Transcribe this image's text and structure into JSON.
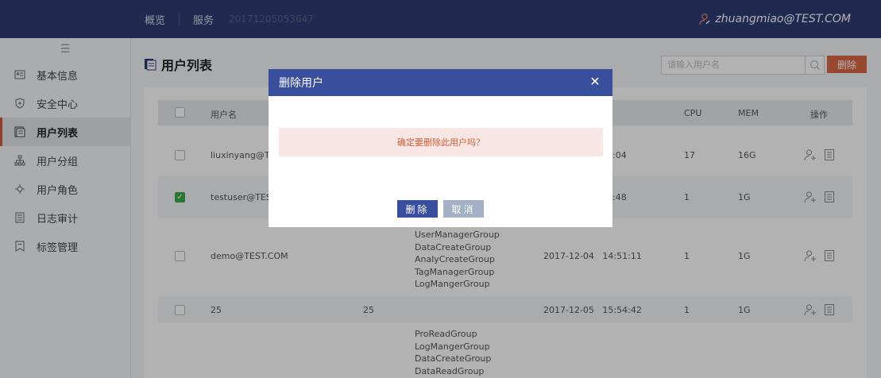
{
  "topbar": {
    "nav": [
      "概览",
      "服务"
    ],
    "service_id": "20171205053647",
    "user": "zhuangmiao@TEST.COM"
  },
  "sidebar": {
    "items": [
      {
        "label": "基本信息",
        "icon": "info-card-icon"
      },
      {
        "label": "安全中心",
        "icon": "shield-icon"
      },
      {
        "label": "用户列表",
        "icon": "user-list-icon",
        "active": true
      },
      {
        "label": "用户分组",
        "icon": "group-tree-icon"
      },
      {
        "label": "用户角色",
        "icon": "role-icon"
      },
      {
        "label": "日志审计",
        "icon": "log-icon"
      },
      {
        "label": "标签管理",
        "icon": "tag-icon"
      }
    ]
  },
  "main": {
    "title": "用户列表",
    "search_placeholder": "请输入用户名",
    "delete_label": "删除"
  },
  "table": {
    "headers": {
      "username": "用户名",
      "cpu": "CPU",
      "mem": "MEM",
      "ops": "操作"
    },
    "rows": [
      {
        "username": "liuxinyang@TEST",
        "time_tail": ":04",
        "cpu": "17",
        "mem": "16G",
        "checked": false
      },
      {
        "username": "testuser@TEST",
        "time_tail": ":48",
        "cpu": "1",
        "mem": "1G",
        "checked": true
      },
      {
        "username": "demo@TEST.COM",
        "groups": [
          "UserManagerGroup",
          "DataCreateGroup",
          "AnalyCreateGroup",
          "TagManagerGroup",
          "LogMangerGroup"
        ],
        "time": "2017-12-04   14:51:11",
        "cpu": "1",
        "mem": "1G",
        "checked": false
      },
      {
        "username": "25",
        "col2": "25",
        "time": "2017-12-05   15:54:42",
        "cpu": "1",
        "mem": "1G",
        "checked": false
      },
      {
        "groups": [
          "ProReadGroup",
          "LogMangerGroup",
          "DataCreateGroup",
          "DataReadGroup"
        ]
      }
    ]
  },
  "modal": {
    "title": "删除用户",
    "message": "确定要删除此用户吗？",
    "ok_label": "删除",
    "cancel_label": "取消"
  },
  "colors": {
    "topbar": "#2f3d74",
    "modal_header": "#3a4e9e",
    "danger": "#dc6746",
    "check": "#3cab4c"
  }
}
